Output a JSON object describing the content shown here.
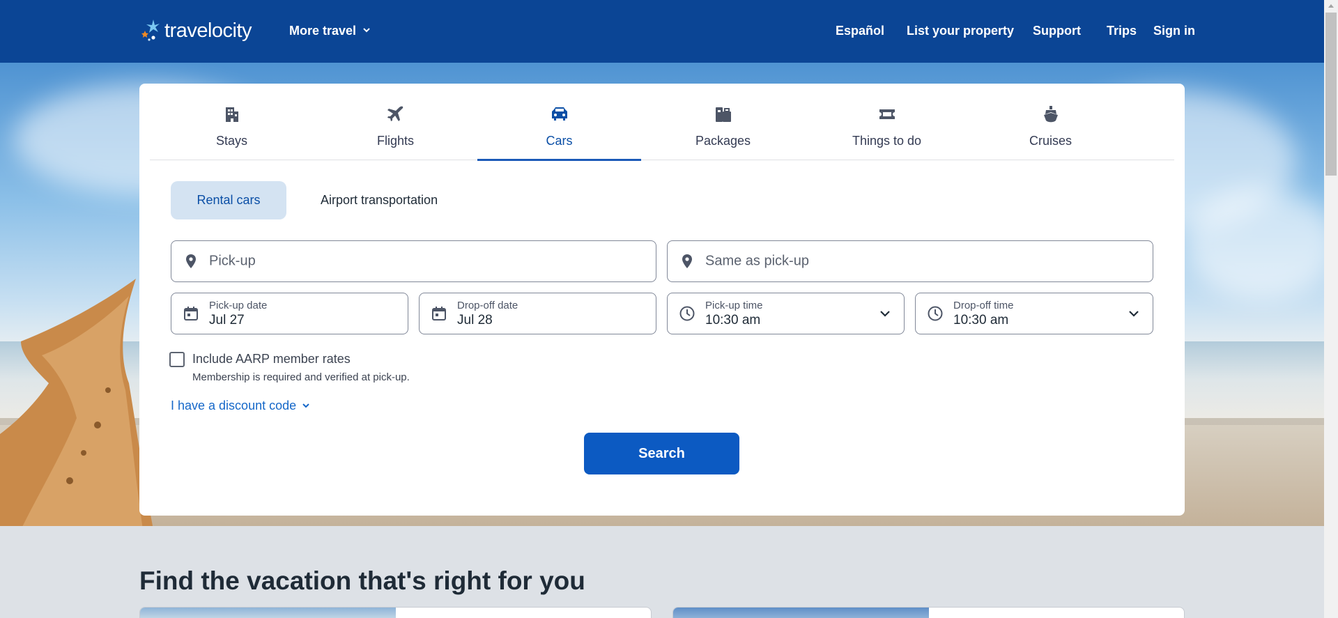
{
  "header": {
    "logo_text": "travelocity",
    "logo_mark": "travelocity-star-logo",
    "more_travel": "More travel",
    "nav": [
      "Español",
      "List your property",
      "Support",
      "Trips",
      "Sign in"
    ],
    "bg_color": "#0b4595"
  },
  "tabs": [
    {
      "label": "Stays",
      "icon": "building-icon"
    },
    {
      "label": "Flights",
      "icon": "plane-icon"
    },
    {
      "label": "Cars",
      "icon": "car-icon",
      "active": true
    },
    {
      "label": "Packages",
      "icon": "luggage-icon"
    },
    {
      "label": "Things to do",
      "icon": "ticket-icon"
    },
    {
      "label": "Cruises",
      "icon": "ship-icon"
    }
  ],
  "subtabs": {
    "rental": "Rental cars",
    "airport": "Airport transportation"
  },
  "fields": {
    "pickup_placeholder": "Pick-up",
    "dropoff_placeholder": "Same as pick-up",
    "pickup_date_label": "Pick-up date",
    "pickup_date_value": "Jul 27",
    "dropoff_date_label": "Drop-off date",
    "dropoff_date_value": "Jul 28",
    "pickup_time_label": "Pick-up time",
    "pickup_time_value": "10:30 am",
    "dropoff_time_label": "Drop-off time",
    "dropoff_time_value": "10:30 am"
  },
  "aarp": {
    "label": "Include AARP member rates",
    "note": "Membership is required and verified at pick-up."
  },
  "discount": "I have a discount code",
  "search_button": "Search",
  "section_heading": "Find the vacation that's right for you",
  "colors": {
    "accent": "#0c5ac2",
    "active_tab": "#1b5ab8",
    "link": "#1668c9"
  }
}
